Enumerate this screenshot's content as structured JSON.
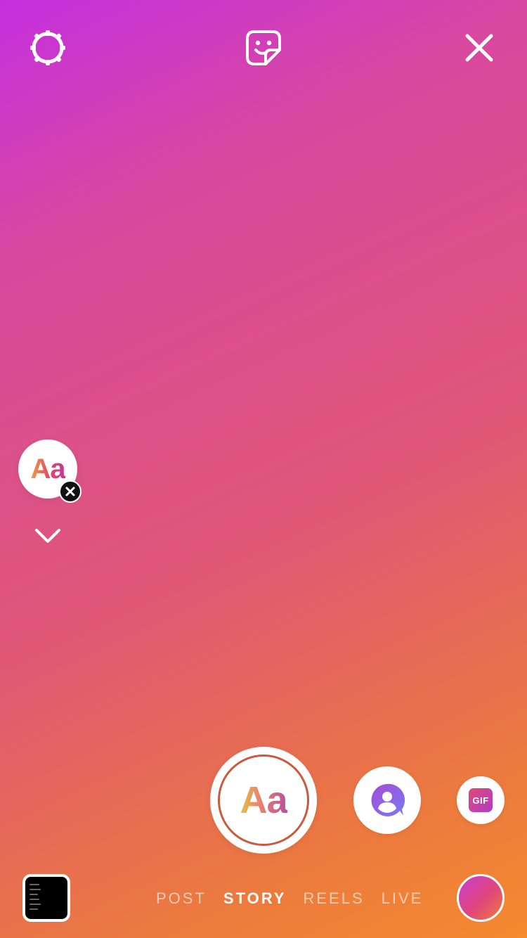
{
  "topbar": {
    "settings_icon": "gear-icon",
    "sticker_icon": "sticker-icon",
    "close_icon": "close-icon"
  },
  "create_mode": {
    "label": "Aa",
    "remove_icon": "close-icon",
    "expand_icon": "chevron-down-icon"
  },
  "capture": {
    "label": "Aa",
    "mention_icon": "mention-icon",
    "gif_label": "GIF"
  },
  "modes": {
    "tabs": [
      {
        "label": "POST",
        "active": false
      },
      {
        "label": "STORY",
        "active": true
      },
      {
        "label": "REELS",
        "active": false
      },
      {
        "label": "LIVE",
        "active": false
      }
    ]
  },
  "colors": {
    "gradient_start": "#c62fe0",
    "gradient_mid": "#df5777",
    "gradient_end": "#f58a2f",
    "white": "#ffffff"
  }
}
